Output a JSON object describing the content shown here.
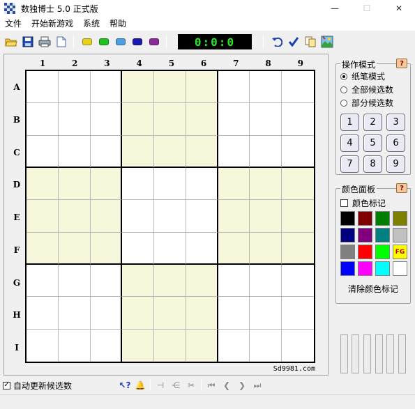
{
  "window": {
    "title": "数独博士 5.0 正式版",
    "minimize": "—",
    "maximize": "☐",
    "close": "✕"
  },
  "menu": [
    "文件",
    "开始新游戏",
    "系统",
    "帮助"
  ],
  "toolbar": {
    "timer": "0:0:0",
    "gem_colors": [
      "#e6d21e",
      "#22c022",
      "#4aa0e0",
      "#1a1ab0",
      "#8a2a9a"
    ]
  },
  "board": {
    "columns": [
      "1",
      "2",
      "3",
      "4",
      "5",
      "6",
      "7",
      "8",
      "9"
    ],
    "rows": [
      "A",
      "B",
      "C",
      "D",
      "E",
      "F",
      "G",
      "H",
      "I"
    ],
    "shade_color": "#f7f7dc",
    "site": "Sd9981.com"
  },
  "mode_panel": {
    "title": "操作模式",
    "help": "?",
    "options": [
      {
        "label": "纸笔模式",
        "selected": true
      },
      {
        "label": "全部候选数",
        "selected": false
      },
      {
        "label": "部分候选数",
        "selected": false
      }
    ],
    "numbers": [
      "1",
      "2",
      "3",
      "4",
      "5",
      "6",
      "7",
      "8",
      "9"
    ]
  },
  "color_panel": {
    "title": "颜色面板",
    "help": "?",
    "color_mark_label": "颜色标记",
    "color_mark_checked": false,
    "swatches": [
      "#000000",
      "#800000",
      "#008000",
      "#808000",
      "#000080",
      "#800080",
      "#008080",
      "#c0c0c0",
      "#808080",
      "#ff0000",
      "#00ff00",
      "#ffff00",
      "#0000ff",
      "#ff00ff",
      "#00ffff",
      "#ffffff"
    ],
    "fg_label": "FG",
    "clear_label": "清除颜色标记"
  },
  "status": {
    "auto_update_label": "自动更新候选数",
    "auto_update_checked": true
  }
}
